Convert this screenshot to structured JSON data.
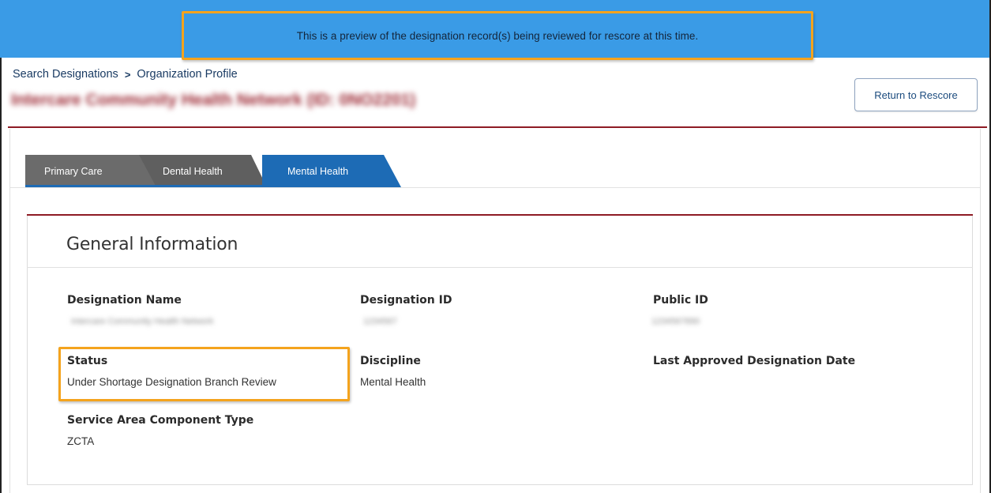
{
  "banner": {
    "message": "This is a preview of the designation record(s) being reviewed for rescore at this time."
  },
  "breadcrumb": {
    "items": [
      "Search Designations",
      "Organization Profile"
    ],
    "separator": ">"
  },
  "header": {
    "org_title": "Intercare Community Health Network (ID: 0NO2201)",
    "return_button": "Return to Rescore"
  },
  "tabs": [
    {
      "label": "Primary Care",
      "active": false
    },
    {
      "label": "Dental Health",
      "active": false
    },
    {
      "label": "Mental Health",
      "active": true
    }
  ],
  "panel": {
    "title": "General Information",
    "fields": {
      "designation_name": {
        "label": "Designation Name",
        "value": "Intercare Community Health Network"
      },
      "designation_id": {
        "label": "Designation ID",
        "value": "1234567"
      },
      "public_id": {
        "label": "Public ID",
        "value": "1234567890"
      },
      "status": {
        "label": "Status",
        "value": "Under Shortage Designation Branch Review"
      },
      "discipline": {
        "label": "Discipline",
        "value": "Mental Health"
      },
      "last_approved": {
        "label": "Last Approved Designation Date",
        "value": ""
      },
      "service_area_type": {
        "label": "Service Area Component Type",
        "value": "ZCTA"
      }
    }
  },
  "colors": {
    "banner_bg": "#3a9be6",
    "highlight": "#f4a31d",
    "accent_rule": "#8e1b24",
    "active_tab": "#1d6bb5"
  }
}
